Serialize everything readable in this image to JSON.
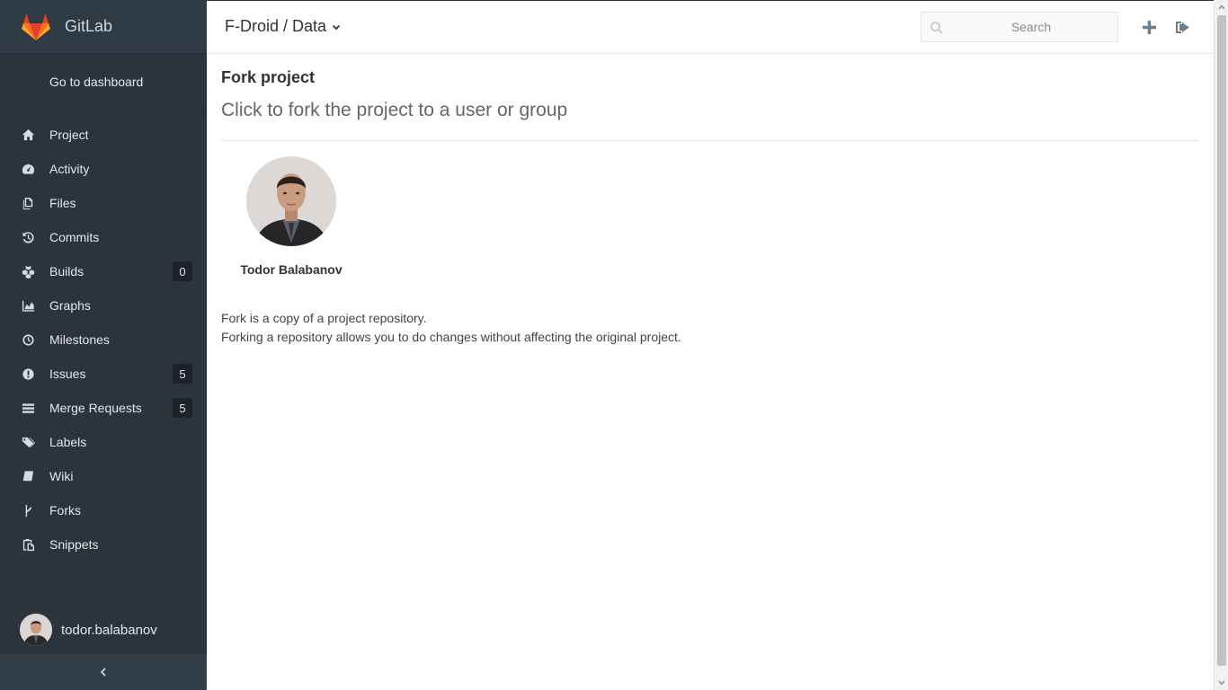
{
  "sidebar": {
    "brand": "GitLab",
    "goto_dashboard": "Go to dashboard",
    "items": [
      {
        "label": "Project",
        "icon": "home-icon"
      },
      {
        "label": "Activity",
        "icon": "dashboard-icon"
      },
      {
        "label": "Files",
        "icon": "files-icon"
      },
      {
        "label": "Commits",
        "icon": "history-icon"
      },
      {
        "label": "Builds",
        "icon": "cubes-icon",
        "count": "0"
      },
      {
        "label": "Graphs",
        "icon": "area-chart-icon"
      },
      {
        "label": "Milestones",
        "icon": "clock-icon"
      },
      {
        "label": "Issues",
        "icon": "exclamation-circle-icon",
        "count": "5"
      },
      {
        "label": "Merge Requests",
        "icon": "tasks-icon",
        "count": "5"
      },
      {
        "label": "Labels",
        "icon": "tags-icon"
      },
      {
        "label": "Wiki",
        "icon": "book-icon"
      },
      {
        "label": "Forks",
        "icon": "code-fork-icon"
      },
      {
        "label": "Snippets",
        "icon": "clipboard-icon"
      }
    ],
    "username": "todor.balabanov",
    "collapse_icon": "angle-left-icon"
  },
  "header": {
    "title": "F-Droid / Data",
    "search_placeholder": "Search",
    "new_icon": "plus-icon",
    "signout_icon": "sign-out-icon"
  },
  "main": {
    "title": "Fork project",
    "lead": "Click to fork the project to a user or group",
    "fork_target": {
      "name": "Todor Balabanov"
    },
    "info_line1": "Fork is a copy of a project repository.",
    "info_line2": "Forking a repository allows you to do changes without affecting the original project."
  },
  "colors": {
    "sidebar_bg": "#2b343c",
    "count_badge_bg": "#1c2227",
    "gitlab_orange": "#fc6d26"
  }
}
